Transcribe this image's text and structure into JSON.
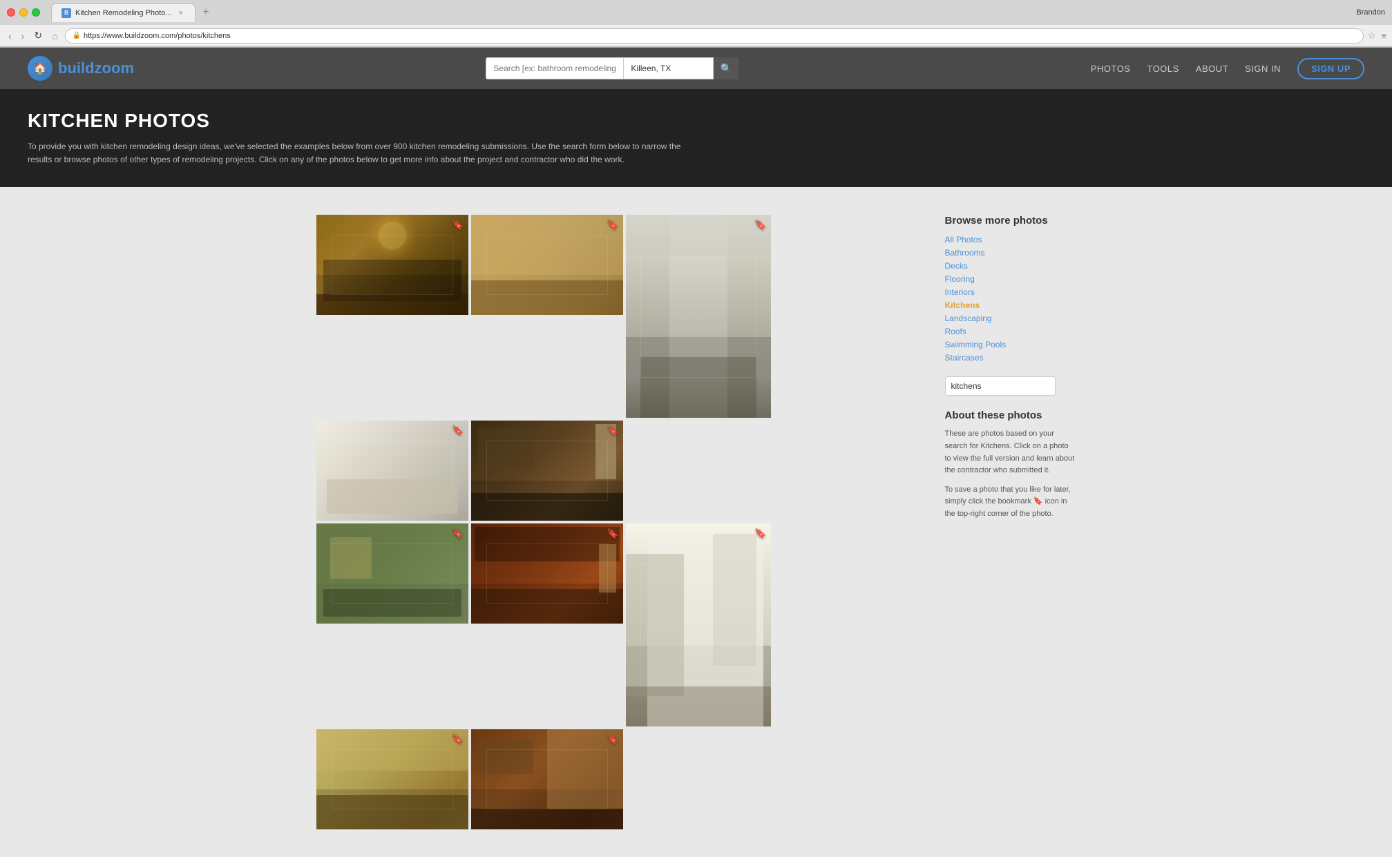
{
  "browser": {
    "tab_title": "Kitchen Remodeling Photo...",
    "url": "https://www.buildzoom.com/photos/kitchens",
    "user": "Brandon"
  },
  "header": {
    "logo_build": "build",
    "logo_zoom": "zoom",
    "search_placeholder": "Search [ex: bathroom remodeling]",
    "location_value": "Killeen, TX",
    "nav_items": [
      "PHOTOS",
      "TOOLS",
      "ABOUT",
      "SIGN IN"
    ],
    "signup_label": "SIGN UP"
  },
  "banner": {
    "title": "KITCHEN PHOTOS",
    "description": "To provide you with kitchen remodeling design ideas, we've selected the examples below from over 900 kitchen remodeling submissions. Use the search form below to narrow the results or browse photos of other types of remodeling projects. Click on any of the photos below to get more info about the project and contractor who did the work."
  },
  "sidebar": {
    "browse_title": "Browse more photos",
    "links": [
      {
        "label": "All Photos",
        "active": false
      },
      {
        "label": "Bathrooms",
        "active": false
      },
      {
        "label": "Decks",
        "active": false
      },
      {
        "label": "Flooring",
        "active": false
      },
      {
        "label": "Interiors",
        "active": false
      },
      {
        "label": "Kitchens",
        "active": true
      },
      {
        "label": "Landscaping",
        "active": false
      },
      {
        "label": "Roofs",
        "active": false
      },
      {
        "label": "Swimming Pools",
        "active": false
      },
      {
        "label": "Staircases",
        "active": false
      }
    ],
    "filter_value": "kitchens",
    "about_title": "About these photos",
    "about_text1": "These are photos based on your search for Kitchens. Click on a photo to view the full version and learn about the contractor who submitted it.",
    "about_text2": "To save a photo that you like for later, simply click the bookmark icon in the top-right corner of the photo."
  }
}
